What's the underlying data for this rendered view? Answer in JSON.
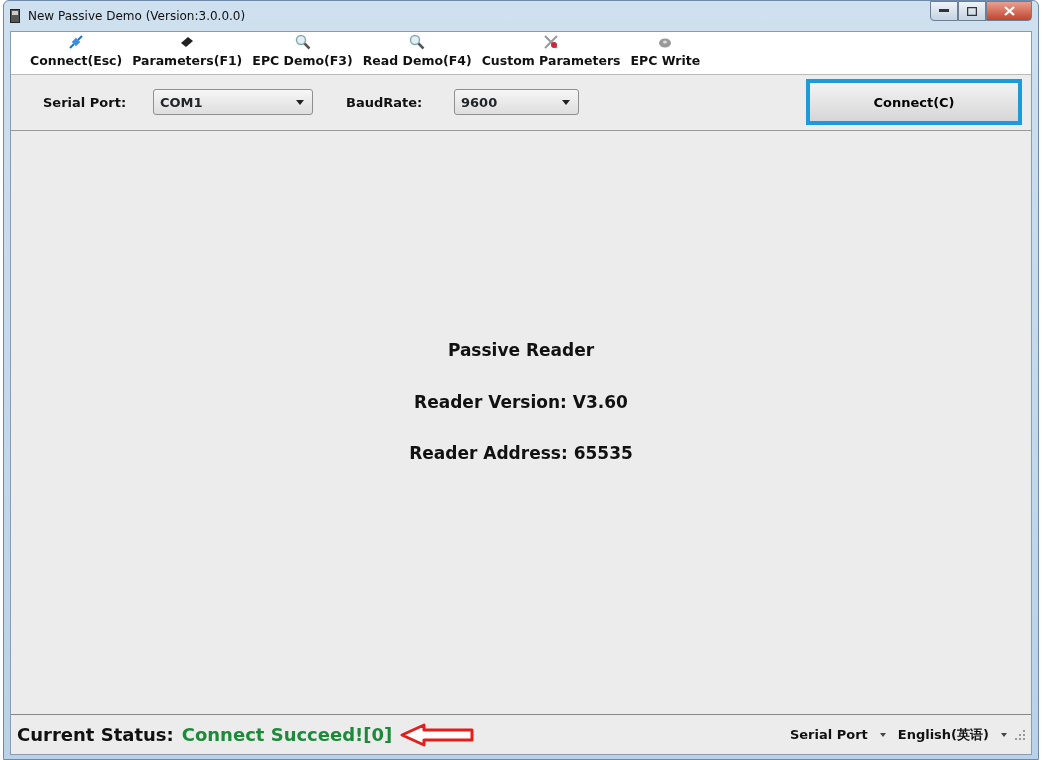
{
  "window": {
    "title": "New Passive Demo (Version:3.0.0.0)"
  },
  "toolbar": [
    {
      "label": "Connect(Esc)"
    },
    {
      "label": "Parameters(F1)"
    },
    {
      "label": "EPC Demo(F3)"
    },
    {
      "label": "Read Demo(F4)"
    },
    {
      "label": "Custom Parameters"
    },
    {
      "label": "EPC Write"
    }
  ],
  "connection": {
    "serial_port_label": "Serial Port:",
    "serial_port": "COM1",
    "baud_rate_label": "BaudRate:",
    "baud_rate": "9600",
    "connect_button": {
      "label": "Connect(C)",
      "focused": true
    }
  },
  "info": [
    "Passive Reader",
    "Reader Version: V3.60",
    "Reader Address: 65535"
  ],
  "status_bar": {
    "label": "Current Status:",
    "status": "Connect Succeed![0]",
    "port_menu": "Serial Port",
    "language_menu": "English(英语)"
  }
}
